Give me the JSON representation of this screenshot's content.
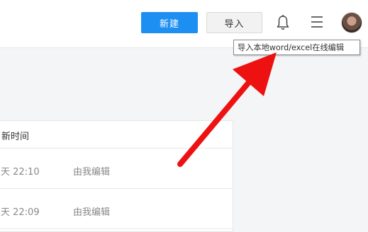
{
  "header": {
    "new_label": "新建",
    "import_label": "导入",
    "icons": [
      "bell-icon",
      "menu-icon"
    ],
    "accent_color": "#1e8ff2"
  },
  "tooltip": {
    "text": "导入本地word/excel在线编辑"
  },
  "table": {
    "column_header": "新时间",
    "rows": [
      {
        "time": "天 22:10",
        "editor": "由我编辑"
      },
      {
        "time": "天 22:09",
        "editor": "由我编辑"
      }
    ]
  },
  "annotation": {
    "arrow_color": "#ee1111"
  }
}
